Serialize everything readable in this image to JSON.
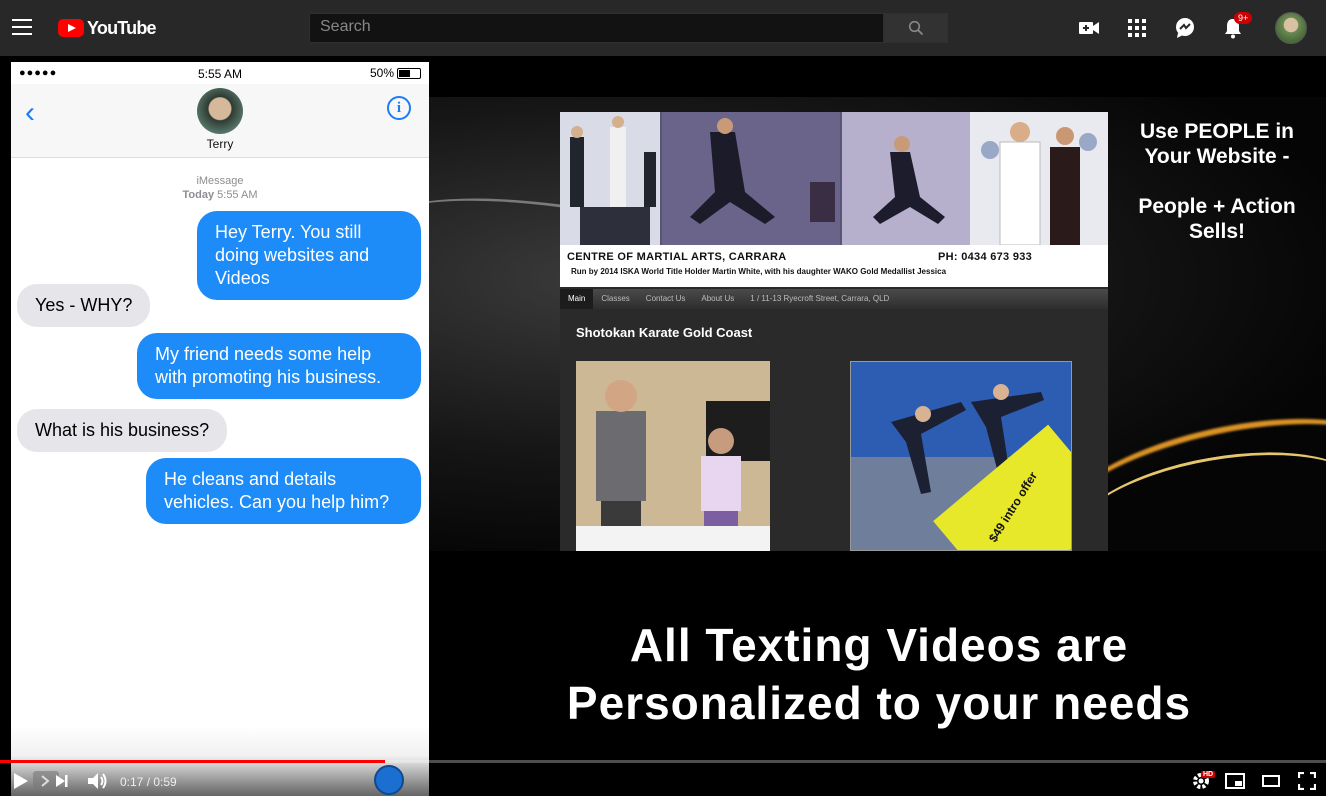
{
  "header": {
    "logo_text": "YouTube",
    "search_placeholder": "Search",
    "notification_count": "9+"
  },
  "phone": {
    "status": {
      "signal": "●●●●●",
      "time": "5:55 AM",
      "battery": "50%"
    },
    "contact_name": "Terry",
    "thread_label": "iMessage",
    "thread_day": "Today",
    "thread_time": "5:55 AM",
    "messages": [
      {
        "from": "me",
        "text": "Hey Terry. You still doing websites and Videos"
      },
      {
        "from": "them",
        "text": "Yes - WHY?"
      },
      {
        "from": "me",
        "text": "My friend needs some help with promoting his business."
      },
      {
        "from": "them",
        "text": "What is his business?"
      },
      {
        "from": "me",
        "text": "He cleans and details vehicles. Can you help him?"
      }
    ]
  },
  "website": {
    "title": "CENTRE OF MARTIAL ARTS, CARRARA",
    "phone": "PH: 0434 673 933",
    "subtitle": "Run by 2014 ISKA World Title Holder Martin White, with his daughter WAKO Gold Medallist Jessica",
    "nav": [
      "Main",
      "Classes",
      "Contact Us",
      "About Us",
      "1 / 11-13 Ryecroft Street, Carrara, QLD"
    ],
    "heading": "Shotokan Karate Gold Coast",
    "promo": "$49 intro offer"
  },
  "captions": {
    "side_line1": "Use PEOPLE in Your Website -",
    "side_line2": "People + Action Sells!",
    "bottom_line1": "All Texting Videos are",
    "bottom_line2": "Personalized to your needs"
  },
  "player": {
    "current_time": "0:17",
    "duration": "0:59",
    "time_display": "0:17 / 0:59",
    "progress_fraction": 0.29,
    "hd_label": "HD"
  },
  "colors": {
    "youtube_red": "#ff0000",
    "imessage_blue": "#1d8bf8",
    "incoming_bubble": "#e6e6ea"
  }
}
